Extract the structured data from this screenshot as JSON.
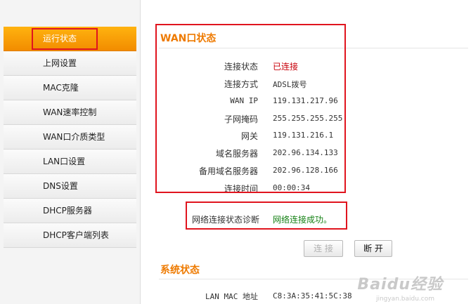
{
  "sidebar": {
    "items": [
      {
        "label": "运行状态"
      },
      {
        "label": "上网设置"
      },
      {
        "label": "MAC克隆"
      },
      {
        "label": "WAN速率控制"
      },
      {
        "label": "WAN口介质类型"
      },
      {
        "label": "LAN口设置"
      },
      {
        "label": "DNS设置"
      },
      {
        "label": "DHCP服务器"
      },
      {
        "label": "DHCP客户端列表"
      }
    ]
  },
  "wan": {
    "title": "WAN口状态",
    "rows": [
      {
        "label": "连接状态",
        "value": "已连接"
      },
      {
        "label": "连接方式",
        "value": "ADSL拨号"
      },
      {
        "label": "WAN IP",
        "value": "119.131.217.96"
      },
      {
        "label": "子网掩码",
        "value": "255.255.255.255"
      },
      {
        "label": "网关",
        "value": "119.131.216.1"
      },
      {
        "label": "域名服务器",
        "value": "202.96.134.133"
      },
      {
        "label": "备用域名服务器",
        "value": "202.96.128.166"
      },
      {
        "label": "连接时间",
        "value": "00:00:34"
      }
    ],
    "diagnosis_label": "网络连接状态诊断",
    "diagnosis_value": "网络连接成功。",
    "connect_button": "连 接",
    "disconnect_button": "断 开"
  },
  "system": {
    "title": "系统状态",
    "lan_mac_label": "LAN MAC 地址",
    "lan_mac_value": "C8:3A:35:41:5C:38"
  },
  "watermark": {
    "text": "Baidu经验",
    "url": "jingyan.baidu.com"
  },
  "colors": {
    "accent": "#ee7a00",
    "highlight": "#e0141e",
    "connected": "#c8000a",
    "success": "#168216"
  }
}
